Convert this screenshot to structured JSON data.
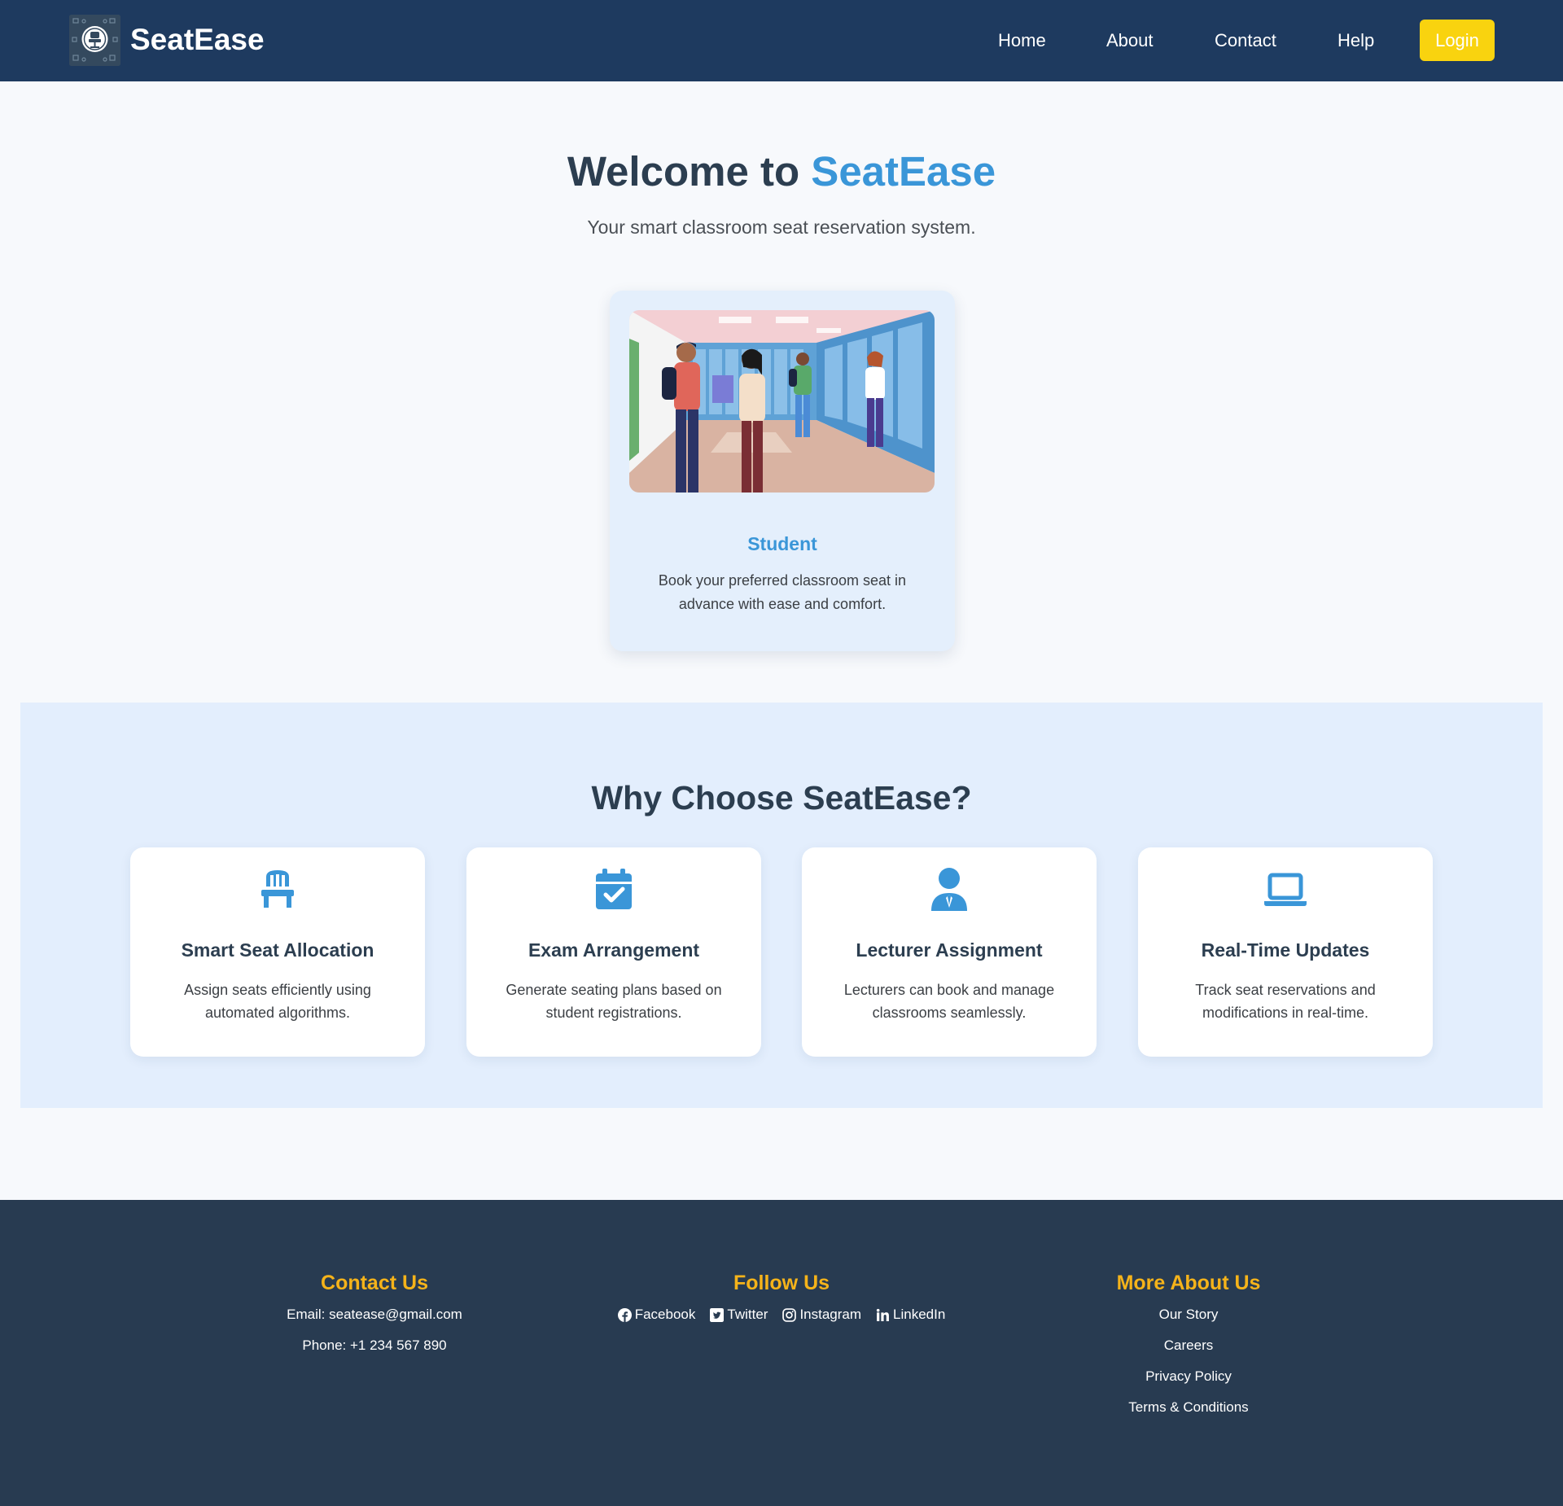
{
  "header": {
    "brand": "SeatEase",
    "logo_icon": "seat-logo-icon",
    "nav": [
      {
        "label": "Home"
      },
      {
        "label": "About"
      },
      {
        "label": "Contact"
      },
      {
        "label": "Help"
      }
    ],
    "login_label": "Login"
  },
  "hero": {
    "title_prefix": "Welcome to ",
    "title_accent": "SeatEase",
    "subtitle": "Your smart classroom seat reservation system."
  },
  "role_card": {
    "title": "Student",
    "description": "Book your preferred classroom seat in advance with ease and comfort."
  },
  "features": {
    "title": "Why Choose SeatEase?",
    "items": [
      {
        "icon": "chair-icon",
        "title": "Smart Seat Allocation",
        "description": "Assign seats efficiently using automated algorithms."
      },
      {
        "icon": "calendar-check-icon",
        "title": "Exam Arrangement",
        "description": "Generate seating plans based on student registrations."
      },
      {
        "icon": "user-tie-icon",
        "title": "Lecturer Assignment",
        "description": "Lecturers can book and manage classrooms seamlessly."
      },
      {
        "icon": "laptop-icon",
        "title": "Real-Time Updates",
        "description": "Track seat reservations and modifications in real-time."
      }
    ]
  },
  "footer": {
    "contact": {
      "title": "Contact Us",
      "email": "Email: seatease@gmail.com",
      "phone": "Phone: +1 234 567 890"
    },
    "follow": {
      "title": "Follow Us",
      "links": [
        {
          "icon": "facebook-icon",
          "label": "Facebook"
        },
        {
          "icon": "twitter-icon",
          "label": "Twitter"
        },
        {
          "icon": "instagram-icon",
          "label": "Instagram"
        },
        {
          "icon": "linkedin-icon",
          "label": "LinkedIn"
        }
      ]
    },
    "more": {
      "title": "More About Us",
      "links": [
        "Our Story",
        "Careers",
        "Privacy Policy",
        "Terms & Conditions"
      ]
    }
  },
  "colors": {
    "navbar": "#1e3a5f",
    "accent_blue": "#3a96d8",
    "login_yellow": "#f9d30f",
    "footer": "#283b51",
    "footer_heading": "#f5b31a",
    "features_bg": "#e3eefd"
  }
}
